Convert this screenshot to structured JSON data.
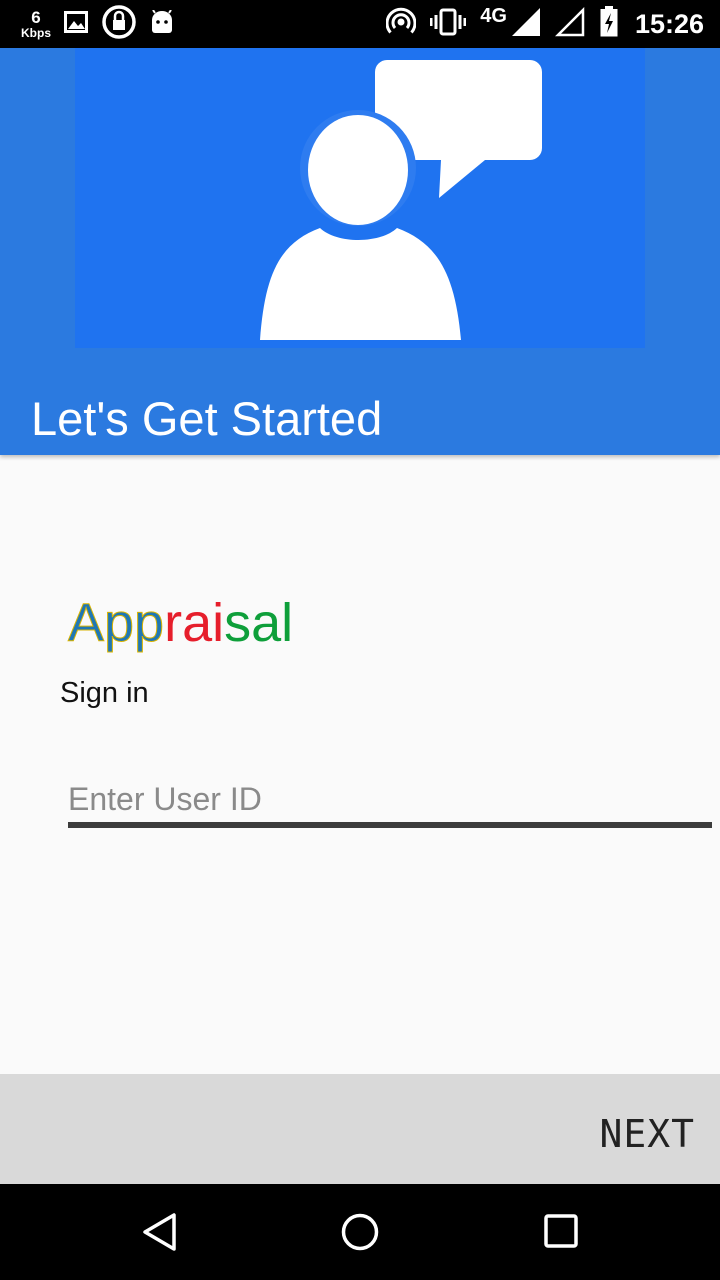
{
  "status_bar": {
    "speed_value": "6",
    "speed_unit": "Kbps",
    "network_type": "4G",
    "time": "15:26",
    "left_icons": [
      "gallery-icon",
      "vpn-lock-icon",
      "android-icon"
    ],
    "right_icons": [
      "hotspot-icon",
      "vibrate-icon",
      "signal-icon",
      "signal-empty-icon",
      "battery-charging-icon"
    ]
  },
  "header": {
    "title": "Let's Get Started",
    "hero_icon": "user-chat-icon"
  },
  "logo": {
    "part1": "App",
    "part2": "rai",
    "part3": "sal"
  },
  "form": {
    "heading": "Sign in",
    "user_id_placeholder": "Enter User ID",
    "user_id_value": ""
  },
  "actions": {
    "next_label": "NEXT"
  },
  "nav": {
    "icons": [
      "back-icon",
      "home-icon",
      "recents-icon"
    ]
  },
  "colors": {
    "header_bg": "#2b7ae0",
    "hero_bg": "#1f73f0",
    "logo_blue": "#1f77b4",
    "logo_red": "#e61e2b",
    "logo_green": "#0e9f3a"
  }
}
